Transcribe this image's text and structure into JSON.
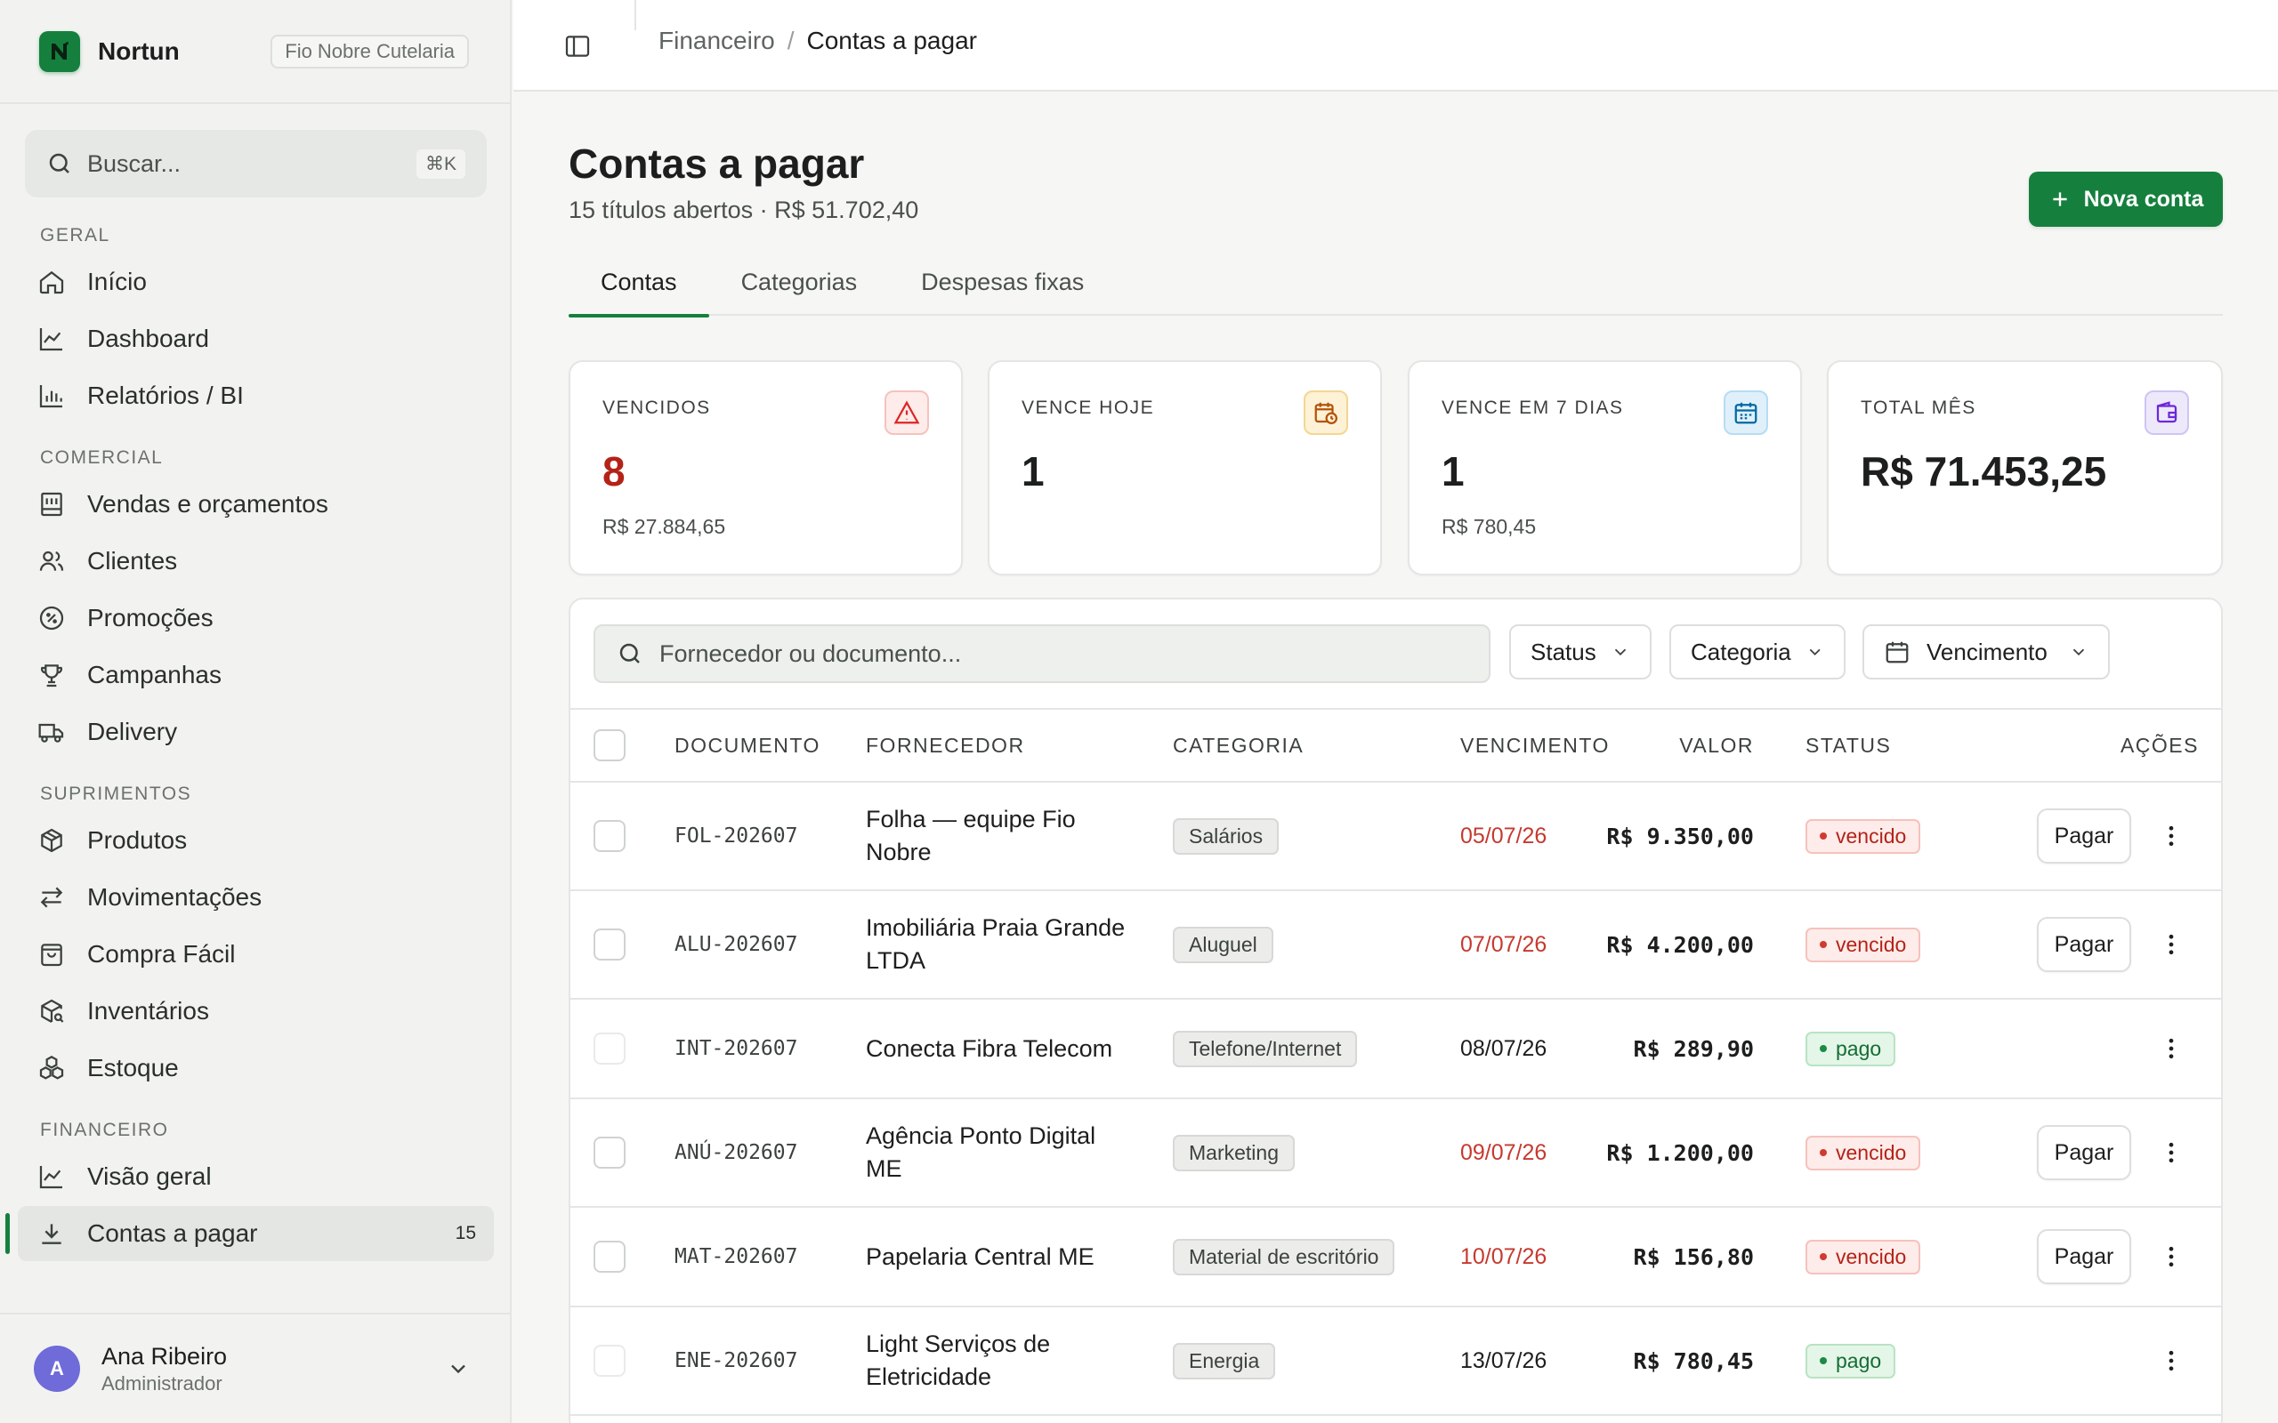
{
  "brand": {
    "name": "Nortun",
    "org": "Fio Nobre Cutelaria",
    "color": "#15803d"
  },
  "search": {
    "placeholder": "Buscar...",
    "shortcut": "⌘K"
  },
  "nav": {
    "sections": [
      {
        "title": "GERAL",
        "items": [
          {
            "label": "Início",
            "icon": "home-icon"
          },
          {
            "label": "Dashboard",
            "icon": "line-chart-icon"
          },
          {
            "label": "Relatórios / BI",
            "icon": "bar-chart-icon"
          }
        ]
      },
      {
        "title": "COMERCIAL",
        "items": [
          {
            "label": "Vendas e orçamentos",
            "icon": "register-icon"
          },
          {
            "label": "Clientes",
            "icon": "users-icon"
          },
          {
            "label": "Promoções",
            "icon": "percent-badge-icon"
          },
          {
            "label": "Campanhas",
            "icon": "trophy-icon"
          },
          {
            "label": "Delivery",
            "icon": "truck-icon"
          }
        ]
      },
      {
        "title": "SUPRIMENTOS",
        "items": [
          {
            "label": "Produtos",
            "icon": "package-icon"
          },
          {
            "label": "Movimentações",
            "icon": "arrows-swap-icon"
          },
          {
            "label": "Compra Fácil",
            "icon": "shopping-bag-icon"
          },
          {
            "label": "Inventários",
            "icon": "package-search-icon"
          },
          {
            "label": "Estoque",
            "icon": "boxes-icon"
          }
        ]
      },
      {
        "title": "FINANCEIRO",
        "items": [
          {
            "label": "Visão geral",
            "icon": "line-chart-icon"
          },
          {
            "label": "Contas a pagar",
            "icon": "download-icon",
            "count": "15",
            "active": true
          }
        ]
      }
    ]
  },
  "user": {
    "initial": "A",
    "name": "Ana Ribeiro",
    "role": "Administrador"
  },
  "breadcrumb": {
    "parent": "Financeiro",
    "separator": "/",
    "current": "Contas a pagar"
  },
  "page": {
    "title": "Contas a pagar",
    "subtitle": "15 títulos abertos · R$ 51.702,40",
    "new_button": "Nova conta"
  },
  "tabs": [
    "Contas",
    "Categorias",
    "Despesas fixas"
  ],
  "cards": [
    {
      "label": "VENCIDOS",
      "value": "8",
      "sub": "R$ 27.884,65",
      "icon": "alert-triangle-icon",
      "tone": "#dc2626",
      "bg": "#fdecea"
    },
    {
      "label": "VENCE HOJE",
      "value": "1",
      "sub": "",
      "icon": "calendar-clock-icon",
      "tone": "#b45309",
      "bg": "#fdf1d6"
    },
    {
      "label": "VENCE EM 7 DIAS",
      "value": "1",
      "sub": "R$ 780,45",
      "icon": "calendar-icon",
      "tone": "#0369a1",
      "bg": "#e0f0fb"
    },
    {
      "label": "TOTAL MÊS",
      "value": "R$ 71.453,25",
      "sub": "",
      "icon": "wallet-icon",
      "tone": "#6d28d9",
      "bg": "#ede9fb"
    }
  ],
  "filters": {
    "search_placeholder": "Fornecedor ou documento...",
    "status": "Status",
    "category": "Categoria",
    "due": "Vencimento"
  },
  "table": {
    "headers": {
      "doc": "DOCUMENTO",
      "supplier": "FORNECEDOR",
      "category": "CATEGORIA",
      "due": "VENCIMENTO",
      "value": "VALOR",
      "status": "STATUS",
      "actions": "AÇÕES"
    },
    "pay_label": "Pagar",
    "rows": [
      {
        "doc": "FOL-202607",
        "supplier": "Folha — equipe Fio Nobre",
        "category": "Salários",
        "due": "05/07/26",
        "value": "R$ 9.350,00",
        "status": "vencido",
        "late": true
      },
      {
        "doc": "ALU-202607",
        "supplier": "Imobiliária Praia Grande LTDA",
        "category": "Aluguel",
        "due": "07/07/26",
        "value": "R$ 4.200,00",
        "status": "vencido",
        "late": true
      },
      {
        "doc": "INT-202607",
        "supplier": "Conecta Fibra Telecom",
        "category": "Telefone/Internet",
        "due": "08/07/26",
        "value": "R$ 289,90",
        "status": "pago",
        "late": false
      },
      {
        "doc": "ANÚ-202607",
        "supplier": "Agência Ponto Digital ME",
        "category": "Marketing",
        "due": "09/07/26",
        "value": "R$ 1.200,00",
        "status": "vencido",
        "late": true
      },
      {
        "doc": "MAT-202607",
        "supplier": "Papelaria Central ME",
        "category": "Material de escritório",
        "due": "10/07/26",
        "value": "R$ 156,80",
        "status": "vencido",
        "late": true
      },
      {
        "doc": "ENE-202607",
        "supplier": "Light Serviços de Eletricidade",
        "category": "Energia",
        "due": "13/07/26",
        "value": "R$ 780,45",
        "status": "pago",
        "late": false
      }
    ]
  }
}
